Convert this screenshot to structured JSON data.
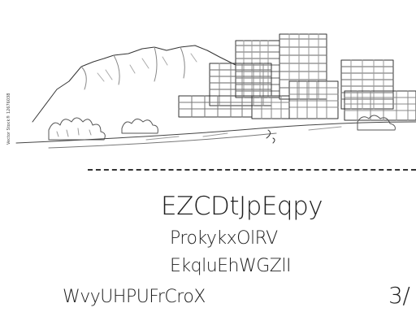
{
  "illustration": {
    "subject": "city-skyline-sketch",
    "credit": "Vector Stock® 12676038"
  },
  "text": {
    "title": "EZCDtJpEqpy",
    "line1": "ProkykxOlRV",
    "line2": "EkqluEhWGZlI",
    "line3": "WvyUHPUFrCroX",
    "page_number": "3/"
  },
  "colors": {
    "background": "#ffffff",
    "ink": "#222222"
  }
}
